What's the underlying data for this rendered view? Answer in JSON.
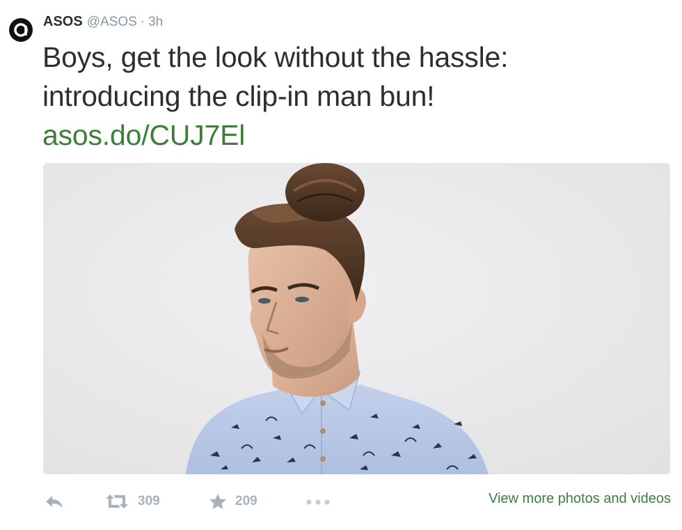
{
  "colors": {
    "link_green": "#3d7f3a",
    "text": "#292f33",
    "muted": "#8899a6",
    "action_grey": "#a7b3bc"
  },
  "tweet": {
    "author_name": "ASOS",
    "handle": "@ASOS",
    "separator": "·",
    "time": "3h",
    "text_line1": "Boys, get the look without the hassle:",
    "text_line2": "introducing the clip-in man bun!",
    "link": "asos.do/CUJ7El"
  },
  "actions": {
    "reply_icon": "reply-icon",
    "retweet_icon": "retweet-icon",
    "retweet_count": "309",
    "favorite_icon": "star-icon",
    "favorite_count": "209",
    "more_icon": "more-dots-icon",
    "view_more": "View more photos and videos"
  }
}
